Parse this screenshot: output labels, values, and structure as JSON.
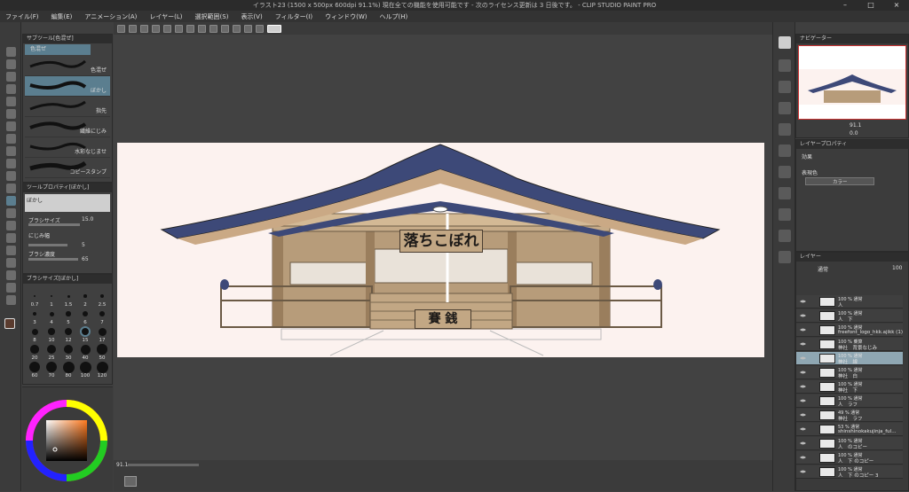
{
  "window": {
    "title": "イラスト23 (1500 x 500px 600dpi 91.1%)  現在全ての機能を使用可能です - 次のライセンス更新は 3 日後です。 - CLIP STUDIO PAINT PRO"
  },
  "menu": [
    "ファイル(F)",
    "編集(E)",
    "アニメーション(A)",
    "レイヤー(L)",
    "選択範囲(S)",
    "表示(V)",
    "フィルター(I)",
    "ウィンドウ(W)",
    "ヘルプ(H)"
  ],
  "subtool": {
    "tab": "サブツール[色混ぜ]",
    "group": "色混ぜ",
    "items": [
      "色混ぜ",
      "ぼかし",
      "指先",
      "繊維にじみ",
      "水彩なじませ",
      "コピースタンプ"
    ]
  },
  "tool_property": {
    "tab": "ツールプロパティ[ぼかし]",
    "current": "ぼかし",
    "brush_size_label": "ブラシサイズ",
    "brush_size": "15.0",
    "blur_label": "にじみ幅",
    "blur": "5",
    "density_label": "ブラシ濃度",
    "density": "65"
  },
  "brush_size_panel": {
    "tab": "ブラシサイズ[ぼかし]",
    "sizes": [
      "0.7",
      "1",
      "1.5",
      "2",
      "2.5",
      "3",
      "4",
      "5",
      "6",
      "7",
      "8",
      "10",
      "12",
      "15",
      "17",
      "20",
      "25",
      "30",
      "40",
      "50",
      "60",
      "70",
      "80",
      "100",
      "120"
    ]
  },
  "canvas": {
    "sign_top": "落ちこぼれ",
    "sign_bottom": "賽 銭",
    "bg_color": "#fcf2ef",
    "roof_color": "#3d4978",
    "wood_color": "#a98d6b"
  },
  "navigator": {
    "tab": "ナビゲーター",
    "zoom": "91.1",
    "rotation": "0.0"
  },
  "layer_property": {
    "tab": "レイヤープロパティ",
    "effect_label": "効果",
    "color_label": "表現色",
    "color_mode": "カラー"
  },
  "layers": {
    "tab": "レイヤー",
    "blend": "通常",
    "opacity": "100",
    "rows": [
      {
        "l1": "100 % 通常",
        "l2": "人"
      },
      {
        "l1": "100 % 通常",
        "l2": "人　下"
      },
      {
        "l1": "100 % 通常",
        "l2": "freefont_logo_hkk.ajikk (1)"
      },
      {
        "l1": "100 % 乗算",
        "l2": "神社　背景なじみ"
      },
      {
        "l1": "100 % 通常",
        "l2": "神社　線"
      },
      {
        "l1": "100 % 通常",
        "l2": "神社　白"
      },
      {
        "l1": "100 % 通常",
        "l2": "神社　下"
      },
      {
        "l1": "100 % 通常",
        "l2": "人　ラフ"
      },
      {
        "l1": "49 % 通常",
        "l2": "神社　ラフ"
      },
      {
        "l1": "53 % 通常",
        "l2": "shinshinokakujinja_ful..."
      },
      {
        "l1": "100 % 通常",
        "l2": "人　のコピー"
      },
      {
        "l1": "100 % 通常",
        "l2": "人　下 のコピー"
      },
      {
        "l1": "100 % 通常",
        "l2": "人　下 のコピー 3"
      }
    ]
  },
  "status": {
    "zoom": "91.1"
  }
}
